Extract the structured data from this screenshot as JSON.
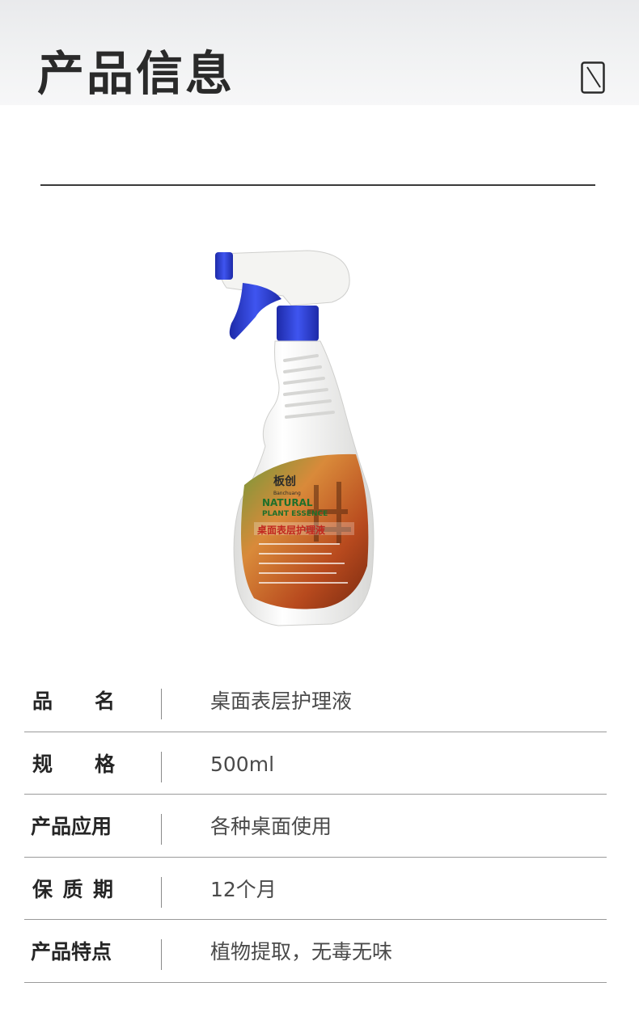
{
  "header": {
    "title": "产品信息",
    "icon": "document-icon"
  },
  "product": {
    "image_label": "product-bottle",
    "brand": "板创",
    "brand_pinyin": "Banchuang",
    "label_line1": "NATURAL",
    "label_line2": "PLANT ESSENCE",
    "label_cn": "桌面表层护理液",
    "colors": {
      "cap": "#2c3fd6",
      "bottle": "#f2f2f0",
      "label_warm": "#c9491f",
      "label_green": "#4a7c2a"
    }
  },
  "specs": [
    {
      "label": "品名",
      "value": "桌面表层护理液"
    },
    {
      "label": "规格",
      "value": "500ml"
    },
    {
      "label": "产品应用",
      "value": "各种桌面使用"
    },
    {
      "label": "保质期",
      "value": "12个月"
    },
    {
      "label": "产品特点",
      "value": "植物提取，无毒无味"
    }
  ]
}
